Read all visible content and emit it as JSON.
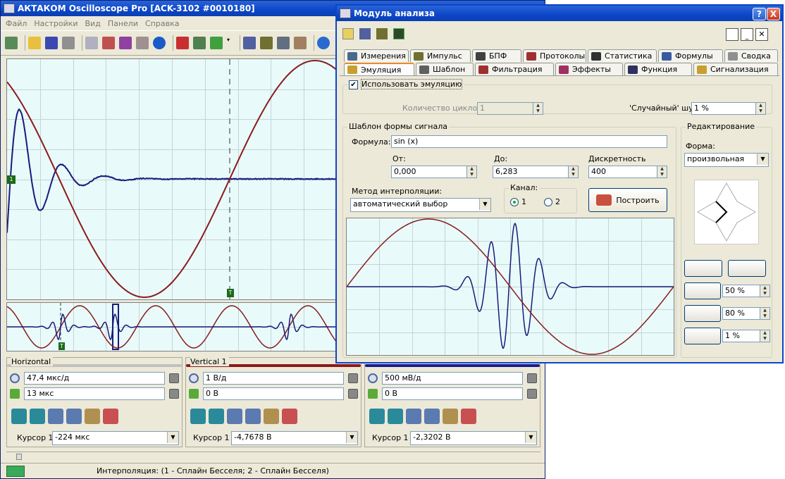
{
  "main_window": {
    "title": "АКТАКОМ Oscilloscope Pro [ACK-3102 #0010180]",
    "menu": [
      "Файл",
      "Настройки",
      "Вид",
      "Панели",
      "Справка"
    ],
    "markers": {
      "channel": "1",
      "trigger": "T"
    },
    "horizontal": {
      "label": "Horizontal",
      "scale": "47,4 мкс/д",
      "offset": "13 мкс",
      "cursor_label": "Курсор 1",
      "cursor_value": "-224 мкс",
      "color": "#c0c0c0"
    },
    "vertical1": {
      "label": "Vertical 1",
      "scale": "1 В/д",
      "offset": "0 В",
      "cursor_label": "Курсор 1",
      "cursor_value": "-4,7678 В",
      "color": "#8b1a1a"
    },
    "vertical2": {
      "scale": "500 мВ/д",
      "offset": "0 В",
      "cursor_label": "Курсор 1",
      "cursor_value": "-2,3202 В",
      "color": "#1a1a8b"
    },
    "status": "Интерполяция: (1 - Сплайн Бесселя; 2 - Сплайн Бесселя)"
  },
  "analysis_window": {
    "title": "Модуль анализа",
    "title_buttons": {
      "help": "?",
      "close": "X"
    },
    "tabs_row1": [
      "Измерения",
      "Импульс",
      "БПФ",
      "Протоколы",
      "Статистика",
      "Формулы",
      "Сводка"
    ],
    "tabs_row2": [
      "Эмуляция",
      "Шаблон",
      "Фильтрация",
      "Эффекты",
      "Функция",
      "Сигнализация"
    ],
    "active_tab": "Эмуляция",
    "use_emulation": {
      "label": "Использовать эмуляцию",
      "checked": true,
      "mark": "✔"
    },
    "cycles": {
      "label": "Количество циклов",
      "value": "1"
    },
    "noise": {
      "label": "'Случайный' шум",
      "value": "1 %"
    },
    "template": {
      "group_label": "Шаблон формы сигнала",
      "formula_label": "Формула:",
      "formula": "sin (x)",
      "from_label": "От:",
      "from": "0,000",
      "to_label": "До:",
      "to": "6,283",
      "discreteness_label": "Дискретность",
      "discreteness": "400",
      "interp_label": "Метод интерполяции:",
      "interp_value": "автоматический выбор",
      "channel_label": "Канал:",
      "channel_options": [
        "1",
        "2"
      ],
      "channel_selected": "1",
      "build_button": "Построить"
    },
    "editing": {
      "group_label": "Редактирование",
      "shape_label": "Форма:",
      "shape_value": "произвольная",
      "pct1": "50 %",
      "pct2": "80 %",
      "pct3": "1 %"
    }
  },
  "colors": {
    "sine": "#8b1a1a",
    "pulse": "#1a1a7a",
    "accent": "#0b46c8"
  }
}
